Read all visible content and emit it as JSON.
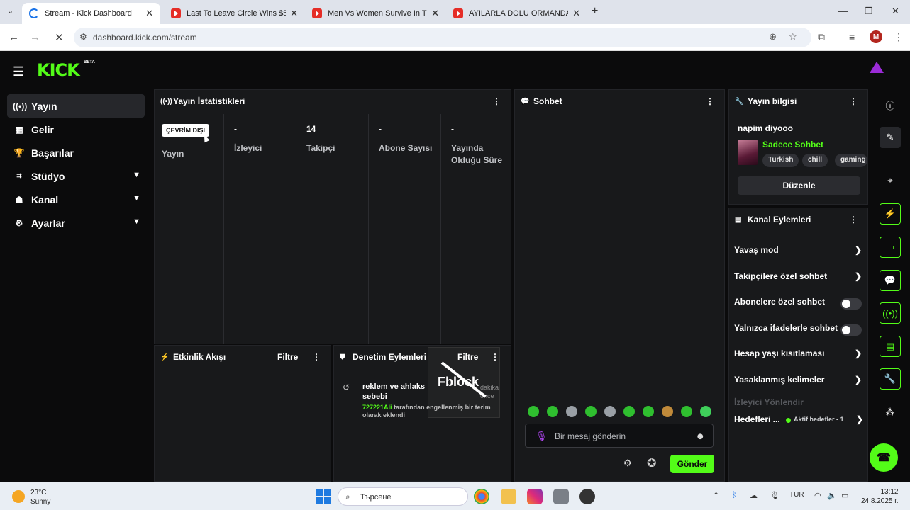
{
  "browser": {
    "tabs": [
      {
        "title": "Stream - Kick Dashboard",
        "icon": "loading-spinner"
      },
      {
        "title": "Last To Leave Circle Wins $500,0",
        "icon": "youtube-icon"
      },
      {
        "title": "Men Vs Women Survive In The",
        "icon": "youtube-icon"
      },
      {
        "title": "AYILARLA DOLU ORMANDA HA",
        "icon": "youtube-icon"
      }
    ],
    "url": "dashboard.kick.com/stream",
    "profile_initial": "M"
  },
  "header": {
    "logo": "KICK",
    "beta": "BETA"
  },
  "sidebar": {
    "items": [
      {
        "label": "Yayın",
        "icon": "broadcast-icon",
        "active": true
      },
      {
        "label": "Gelir",
        "icon": "chart-icon"
      },
      {
        "label": "Başarılar",
        "icon": "trophy-icon"
      },
      {
        "label": "Stüdyo",
        "icon": "studio-icon",
        "expandable": true
      },
      {
        "label": "Kanal",
        "icon": "channel-icon",
        "expandable": true
      },
      {
        "label": "Ayarlar",
        "icon": "gear-icon",
        "expandable": true
      }
    ]
  },
  "stats": {
    "title": "Yayın İstatistikleri",
    "status": "ÇEVRİM DIŞI",
    "columns": [
      {
        "value": "",
        "label": "Yayın"
      },
      {
        "value": "-",
        "label": "İzleyici"
      },
      {
        "value": "14",
        "label": "Takipçi"
      },
      {
        "value": "-",
        "label": "Abone Sayısı"
      },
      {
        "value": "-",
        "label": "Yayında Olduğu Süre"
      }
    ]
  },
  "chat": {
    "title": "Sohbet",
    "placeholder": "Bir mesaj gönderin",
    "send_label": "Gönder"
  },
  "activity": {
    "title": "Etkinlik Akışı",
    "filter": "Filtre"
  },
  "moderation": {
    "title": "Denetim Eylemleri",
    "filter": "Filtre",
    "item": {
      "text": "reklem ve ahlaks",
      "text_end": "sebebi",
      "user": "727221Ali",
      "line2": "tarafından engellenmiş bir terim olarak eklendi",
      "time": "dakika önce"
    },
    "overlay_text": "Fblock"
  },
  "stream_info": {
    "title": "Yayın bilgisi",
    "stream_title": "napim diyooo",
    "category": "Sadece Sohbet",
    "tags": [
      "Turkish",
      "chill",
      "gaming"
    ],
    "edit_label": "Düzenle"
  },
  "channel_actions": {
    "title": "Kanal Eylemleri",
    "rows": [
      {
        "label": "Yavaş mod",
        "type": "arrow"
      },
      {
        "label": "Takipçilere özel sohbet",
        "type": "arrow"
      },
      {
        "label": "Abonelere özel sohbet",
        "type": "toggle"
      },
      {
        "label": "Yalnızca ifadelerle sohbet",
        "type": "toggle"
      },
      {
        "label": "Hesap yaşı kısıtlaması",
        "type": "arrow"
      },
      {
        "label": "Yasaklanmış kelimeler",
        "type": "arrow"
      }
    ],
    "section": "İzleyici Yönlendir",
    "goals_label": "Hedefleri ...",
    "goals_sub": "Aktif hedefler - 1"
  },
  "taskbar": {
    "temp": "23°C",
    "weather": "Sunny",
    "search_placeholder": "Търсене",
    "lang": "TUR",
    "time": "13:12",
    "date": "24.8.2025 г."
  },
  "colors": {
    "accent": "#53fc18",
    "panel": "#18191b",
    "bg": "#0b0b0c"
  }
}
